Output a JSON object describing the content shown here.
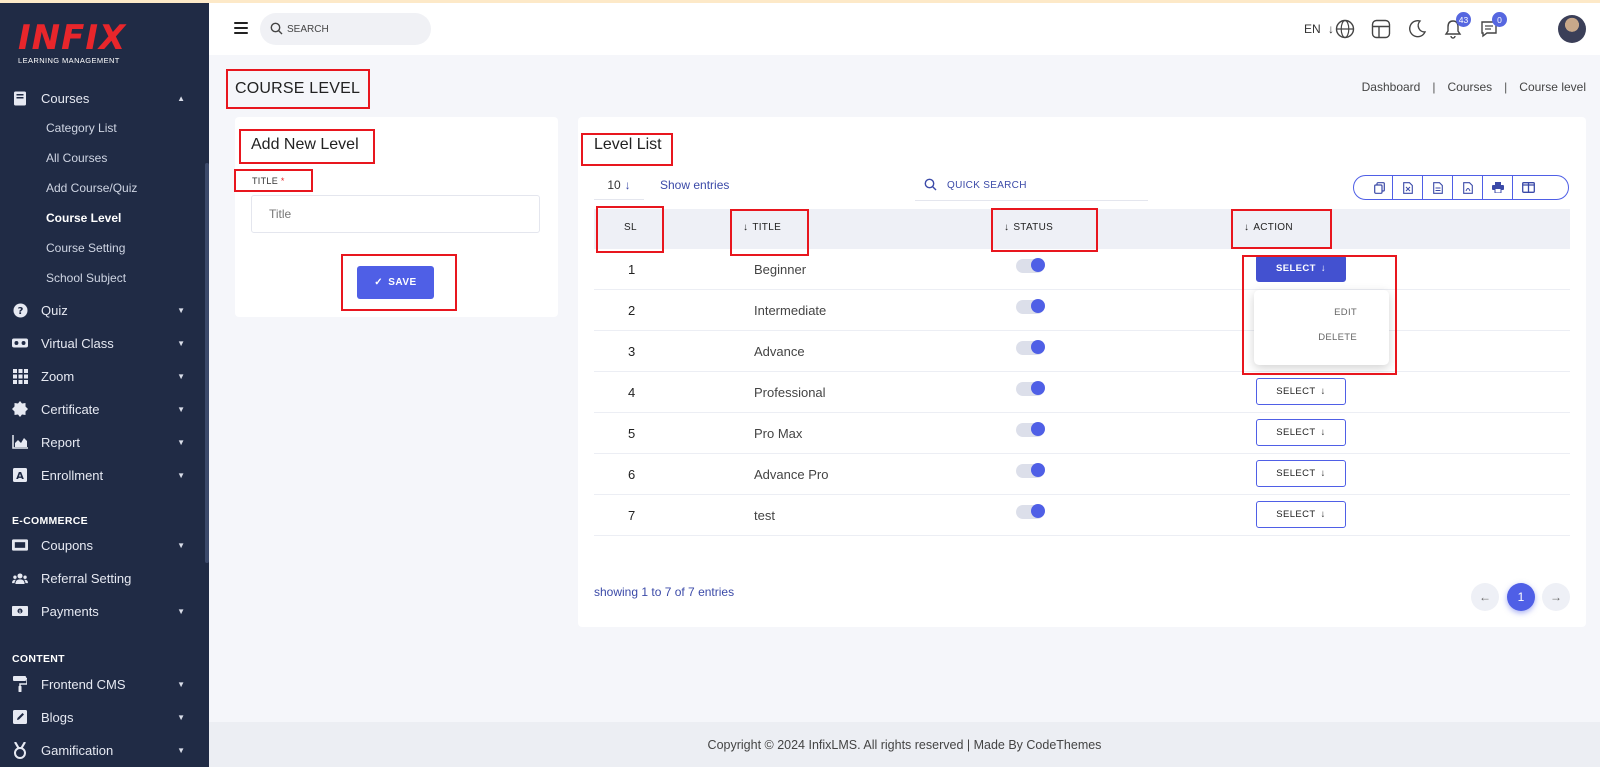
{
  "app": {
    "logo_text": "INFIX",
    "logo_sub": "LEARNING MANAGEMENT"
  },
  "sidebar": {
    "courses": {
      "label": "Courses",
      "icon": "book-icon",
      "subitems": [
        "Category List",
        "All Courses",
        "Add Course/Quiz",
        "Course Level",
        "Course Setting",
        "School Subject"
      ],
      "active": "Course Level"
    },
    "items": [
      {
        "label": "Quiz",
        "icon": "question-circle-icon"
      },
      {
        "label": "Virtual Class",
        "icon": "vr-headset-icon"
      },
      {
        "label": "Zoom",
        "icon": "grid-icon"
      },
      {
        "label": "Certificate",
        "icon": "certificate-icon"
      },
      {
        "label": "Report",
        "icon": "chart-area-icon"
      },
      {
        "label": "Enrollment",
        "icon": "enrollment-icon"
      }
    ],
    "section_ecommerce": "E-COMMERCE",
    "ecommerce_items": [
      {
        "label": "Coupons",
        "icon": "ticket-icon"
      },
      {
        "label": "Referral Setting",
        "icon": "users-icon"
      },
      {
        "label": "Payments",
        "icon": "money-icon"
      }
    ],
    "section_content": "CONTENT",
    "content_items": [
      {
        "label": "Frontend CMS",
        "icon": "paint-roller-icon"
      },
      {
        "label": "Blogs",
        "icon": "edit-icon"
      },
      {
        "label": "Gamification",
        "icon": "medal-icon"
      }
    ]
  },
  "topbar": {
    "search_placeholder": "SEARCH",
    "language": "EN",
    "notifications_count": "43",
    "messages_count": "0"
  },
  "page": {
    "title": "COURSE LEVEL",
    "breadcrumb": [
      "Dashboard",
      "Courses",
      "Course level"
    ]
  },
  "add_form": {
    "title": "Add New Level",
    "field_label": "TITLE",
    "required_mark": "*",
    "placeholder": "Title",
    "save_label": "SAVE"
  },
  "level_list": {
    "title": "Level List",
    "entries_value": "10",
    "entries_label": "Show entries",
    "search_placeholder": "QUICK SEARCH",
    "export_buttons": [
      "copy-icon",
      "excel-icon",
      "csv-icon",
      "pdf-icon",
      "print-icon",
      "columns-icon"
    ],
    "columns": {
      "sl": "SL",
      "title": "TITLE",
      "status": "STATUS",
      "action": "ACTION"
    },
    "rows": [
      {
        "sl": "1",
        "title": "Beginner",
        "status": true
      },
      {
        "sl": "2",
        "title": "Intermediate",
        "status": true
      },
      {
        "sl": "3",
        "title": "Advance",
        "status": true
      },
      {
        "sl": "4",
        "title": "Professional",
        "status": true
      },
      {
        "sl": "5",
        "title": "Pro Max",
        "status": true
      },
      {
        "sl": "6",
        "title": "Advance Pro",
        "status": true
      },
      {
        "sl": "7",
        "title": "test",
        "status": true
      }
    ],
    "select_label": "SELECT",
    "dropdown": {
      "edit": "EDIT",
      "delete": "DELETE"
    },
    "showing": "showing 1 to 7 of 7 entries",
    "current_page": "1"
  },
  "footer": {
    "text": "Copyright © 2024 InfixLMS. All rights reserved | Made By CodeThemes"
  },
  "colors": {
    "sidebar_bg": "#202b45",
    "accent": "#4f5fe6",
    "logo_red": "#e8262b",
    "highlight": "#e8161e"
  }
}
